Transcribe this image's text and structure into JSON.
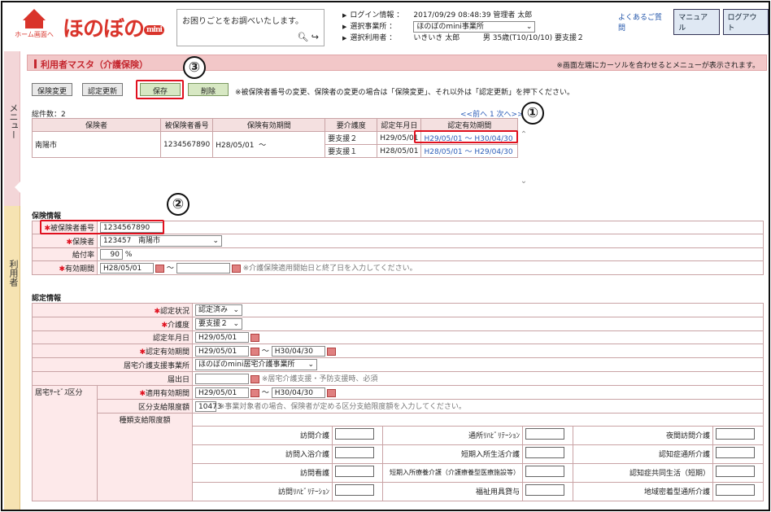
{
  "header": {
    "home_label": "ホーム画面へ",
    "logo": "ほのぼの",
    "logo_mini": "mini",
    "search_placeholder": "お困りごとをお調べいたします。",
    "login_label": "ログイン情報",
    "login_value": "2017/09/29 08:48:39  管理者   太郎",
    "office_label": "選択事業所",
    "office_value": "ほのぼのmini事業所",
    "user_label": "選択利用者",
    "user_value": "いきいき 太郎          男 35歳(T10/10/10) 要支援２",
    "faq": "よくあるご質問",
    "manual": "マニュアル",
    "logout": "ログアウト"
  },
  "side": {
    "menu": "メニュー",
    "user": "利用者"
  },
  "page": {
    "title": "利用者マスタ（介護保険）",
    "note": "※画面左端にカーソルを合わせるとメニューが表示されます。"
  },
  "toolbar": {
    "change": "保険変更",
    "update": "認定更新",
    "save": "保存",
    "delete": "削除",
    "hint": "※被保険者番号の変更、保険者の変更の場合は「保険変更」、それ以外は「認定更新」を押下ください。"
  },
  "callouts": [
    "①",
    "②",
    "③"
  ],
  "insurance_list": {
    "total": "総件数：2",
    "pager": "<<前へ  1  次へ>>",
    "headers": [
      "保険者",
      "被保険者番号",
      "保険有効期間",
      "要介護度",
      "認定年月日",
      "認定有効期間"
    ],
    "insurer": "南陽市",
    "number": "1234567890",
    "period": "H28/05/01  〜",
    "rows": [
      {
        "level": "要支援２",
        "date": "H29/05/01",
        "valid": "H29/05/01 〜 H30/04/30"
      },
      {
        "level": "要支援１",
        "date": "H28/05/01",
        "valid": "H28/05/01 〜 H29/04/30"
      }
    ]
  },
  "insurance_info": {
    "section": "保険情報",
    "number_label": "被保険者番号",
    "number_value": "1234567890",
    "insurer_label": "保険者",
    "insurer_value": "123457   南陽市",
    "rate_label": "給付率",
    "rate_value": "90",
    "rate_unit": "%",
    "period_label": "有効期間",
    "period_from": "H28/05/01",
    "period_note": "※介護保険適用開始日と終了日を入力してください。"
  },
  "cert_info": {
    "section": "認定情報",
    "status_label": "認定状況",
    "status_value": "認定済み",
    "level_label": "介護度",
    "level_value": "要支援２",
    "date_label": "認定年月日",
    "date_value": "H29/05/01",
    "valid_label": "認定有効期間",
    "valid_from": "H29/05/01",
    "valid_to": "H30/04/30",
    "office_label": "居宅介護支援事業所",
    "office_value": "ほのぼのmini居宅介護事業所",
    "report_label": "届出日",
    "report_note": "※居宅介護支援・予防支援時、必須",
    "group_label": "居宅ｻｰﾋﾞｽ区分",
    "apply_label": "適用有効期間",
    "apply_from": "H29/05/01",
    "apply_to": "H30/04/30",
    "limit_label": "区分支給限度額",
    "limit_value": "10473",
    "limit_note": "※事業対象者の場合、保険者が定める区分支給限度額を入力してください。",
    "kind_label": "種類支給限度額",
    "services": [
      [
        "訪問介護",
        "通所ﾘﾊﾋﾞﾘﾃｰｼｮﾝ",
        "夜間訪問介護"
      ],
      [
        "訪問入浴介護",
        "短期入所生活介護",
        "認知症通所介護"
      ],
      [
        "訪問看護",
        "短期入所療養介護（介護療養型医療施設等）",
        "認知症共同生活（短期）"
      ],
      [
        "訪問ﾘﾊﾋﾞﾘﾃｰｼｮﾝ",
        "福祉用具貸与",
        "地域密着型通所介護"
      ]
    ]
  }
}
